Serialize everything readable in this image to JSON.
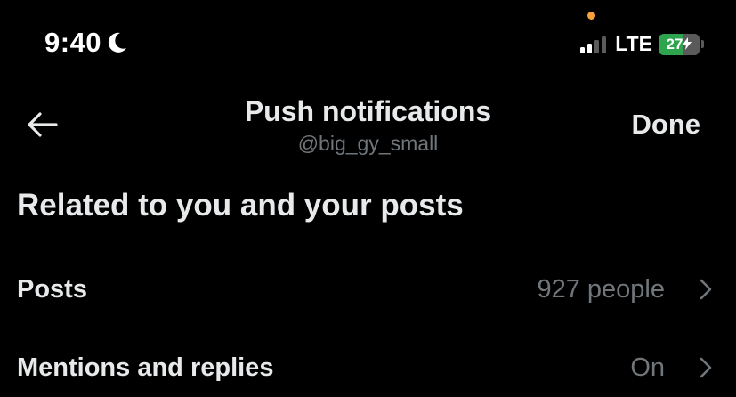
{
  "status_bar": {
    "time": "9:40",
    "network": "LTE",
    "battery": "27",
    "battery_level": 0.27,
    "signal_bars": 2,
    "signal_bars_total": 4,
    "moon_icon": "moon-icon",
    "charging_icon": "bolt-icon",
    "privacy_dot_color": "#f5a03a",
    "battery_color": "#2ea44f"
  },
  "header": {
    "back_icon": "arrow-left-icon",
    "title": "Push notifications",
    "subtitle": "@big_gy_small",
    "done_label": "Done"
  },
  "section": {
    "heading": "Related to you and your posts",
    "rows": [
      {
        "label": "Posts",
        "value": "927 people",
        "icon": "chevron-right-icon"
      },
      {
        "label": "Mentions and replies",
        "value": "On",
        "icon": "chevron-right-icon"
      }
    ]
  },
  "colors": {
    "background": "#000000",
    "primary_text": "#e7e9ea",
    "secondary_text": "#71767b"
  }
}
